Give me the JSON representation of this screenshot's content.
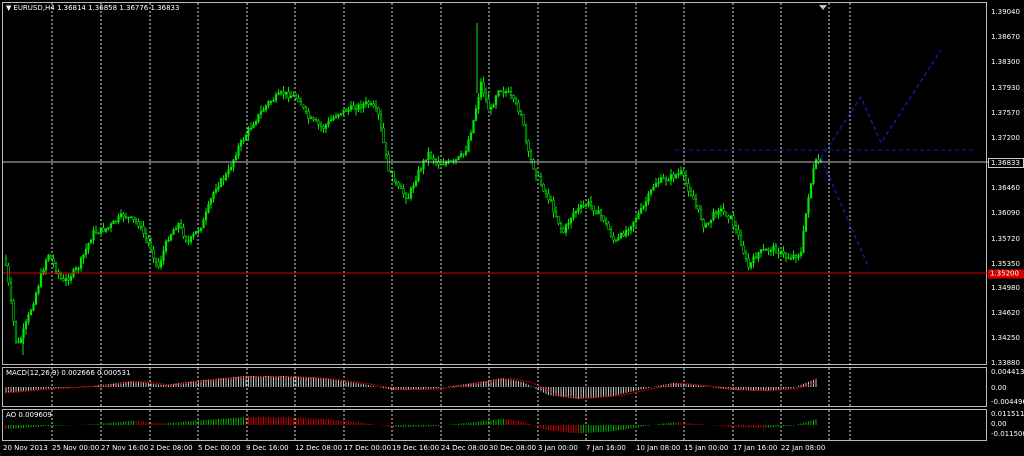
{
  "chart": {
    "symbol_label": "EURUSD,H4",
    "ohlc": [
      "1.36814",
      "1.36858",
      "1.36776",
      "1.36833"
    ],
    "colors": {
      "background": "#000000",
      "bull": "#00e600",
      "grid": "#ffffff",
      "current_line": "#c0c0c0",
      "red_line": "#d40000",
      "projection": "#1a1ab0",
      "macd_hist": "#c0c0c0",
      "macd_signal": "#e60000",
      "ao_up": "#00b000",
      "ao_down": "#d00000"
    }
  },
  "price_axis": {
    "ticks": [
      "1.39040",
      "1.38670",
      "1.38300",
      "1.37930",
      "1.37570",
      "1.37200",
      "1.36460",
      "1.36090",
      "1.35720",
      "1.35350",
      "1.34980",
      "1.34620",
      "1.34250",
      "1.33880"
    ],
    "current_price": "1.36833",
    "red_line_price": "1.35200"
  },
  "macd": {
    "label": "MACD(12,26,9) 0.002666 0.000531",
    "ticks": [
      "0.004413",
      "0.00",
      "-0.004496"
    ]
  },
  "ao": {
    "label": "AO 0.009609",
    "ticks": [
      "0.011511",
      "0.00",
      "-0.011500"
    ]
  },
  "time_axis": {
    "ticks": [
      "20 Nov 2013",
      "25 Nov 00:00",
      "27 Nov 16:00",
      "2 Dec 08:00",
      "5 Dec 00:00",
      "9 Dec 16:00",
      "12 Dec 08:00",
      "17 Dec 00:00",
      "19 Dec 16:00",
      "24 Dec 08:00",
      "30 Dec 08:00",
      "3 Jan 00:00",
      "7 Jan 16:00",
      "10 Jan 08:00",
      "15 Jan 00:00",
      "17 Jan 16:00",
      "22 Jan 08:00"
    ]
  }
}
